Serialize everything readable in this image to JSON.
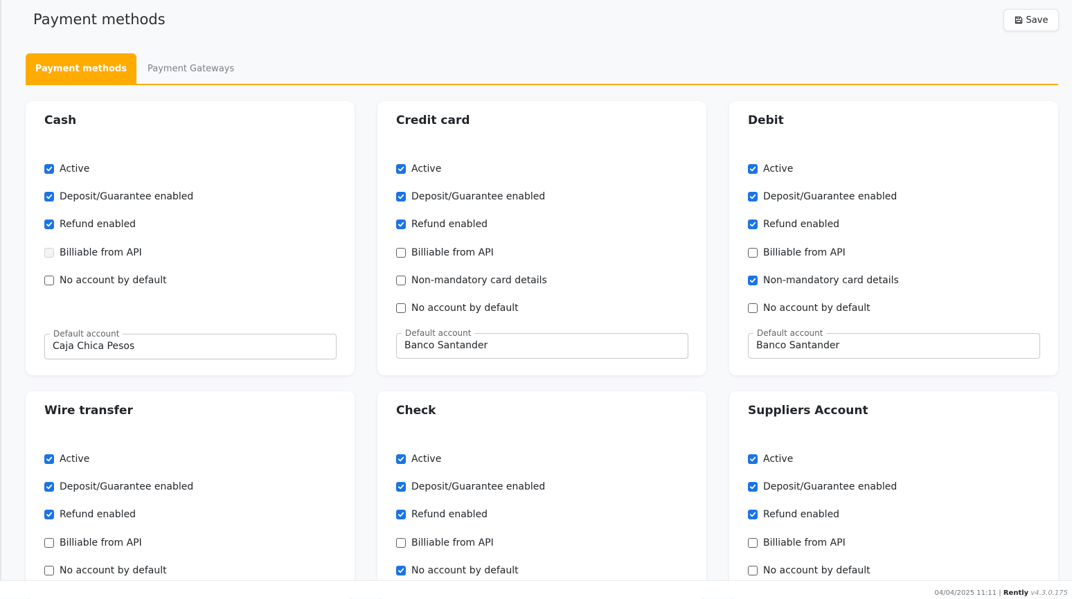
{
  "page": {
    "title": "Payment methods"
  },
  "toolbar": {
    "save_label": "Save",
    "save_icon": "floppy-disk-icon"
  },
  "tabs": [
    {
      "label": "Payment methods",
      "active": true
    },
    {
      "label": "Payment Gateways",
      "active": false
    }
  ],
  "colors": {
    "accent": "#ffab00",
    "checkbox": "#1a73e8"
  },
  "cards": [
    {
      "title": "Cash",
      "checks": [
        {
          "label": "Active",
          "checked": true
        },
        {
          "label": "Deposit/Guarantee enabled",
          "checked": true
        },
        {
          "label": "Refund enabled",
          "checked": true
        },
        {
          "label": "Billiable from API",
          "checked": false,
          "disabled": true
        },
        {
          "label": "No account by default",
          "checked": false
        }
      ],
      "account": {
        "label": "Default account",
        "value": "Caja Chica Pesos"
      }
    },
    {
      "title": "Credit card",
      "checks": [
        {
          "label": "Active",
          "checked": true
        },
        {
          "label": "Deposit/Guarantee enabled",
          "checked": true
        },
        {
          "label": "Refund enabled",
          "checked": true
        },
        {
          "label": "Billiable from API",
          "checked": false
        },
        {
          "label": "Non-mandatory card details",
          "checked": false
        },
        {
          "label": "No account by default",
          "checked": false
        }
      ],
      "account": {
        "label": "Default account",
        "value": "Banco Santander"
      }
    },
    {
      "title": "Debit",
      "checks": [
        {
          "label": "Active",
          "checked": true
        },
        {
          "label": "Deposit/Guarantee enabled",
          "checked": true
        },
        {
          "label": "Refund enabled",
          "checked": true
        },
        {
          "label": "Billiable from API",
          "checked": false
        },
        {
          "label": "Non-mandatory card details",
          "checked": true
        },
        {
          "label": "No account by default",
          "checked": false
        }
      ],
      "account": {
        "label": "Default account",
        "value": "Banco Santander"
      }
    },
    {
      "title": "Wire transfer",
      "checks": [
        {
          "label": "Active",
          "checked": true
        },
        {
          "label": "Deposit/Guarantee enabled",
          "checked": true
        },
        {
          "label": "Refund enabled",
          "checked": true
        },
        {
          "label": "Billiable from API",
          "checked": false
        },
        {
          "label": "No account by default",
          "checked": false
        }
      ]
    },
    {
      "title": "Check",
      "checks": [
        {
          "label": "Active",
          "checked": true
        },
        {
          "label": "Deposit/Guarantee enabled",
          "checked": true
        },
        {
          "label": "Refund enabled",
          "checked": true
        },
        {
          "label": "Billiable from API",
          "checked": false
        },
        {
          "label": "No account by default",
          "checked": true
        }
      ]
    },
    {
      "title": "Suppliers Account",
      "checks": [
        {
          "label": "Active",
          "checked": true
        },
        {
          "label": "Deposit/Guarantee enabled",
          "checked": true
        },
        {
          "label": "Refund enabled",
          "checked": true
        },
        {
          "label": "Billiable from API",
          "checked": false
        },
        {
          "label": "No account by default",
          "checked": false
        }
      ]
    }
  ],
  "footer": {
    "datetime": "04/04/2025 11:11",
    "separator": "|",
    "brand": "Rently",
    "version": "v4.3.0.175"
  }
}
